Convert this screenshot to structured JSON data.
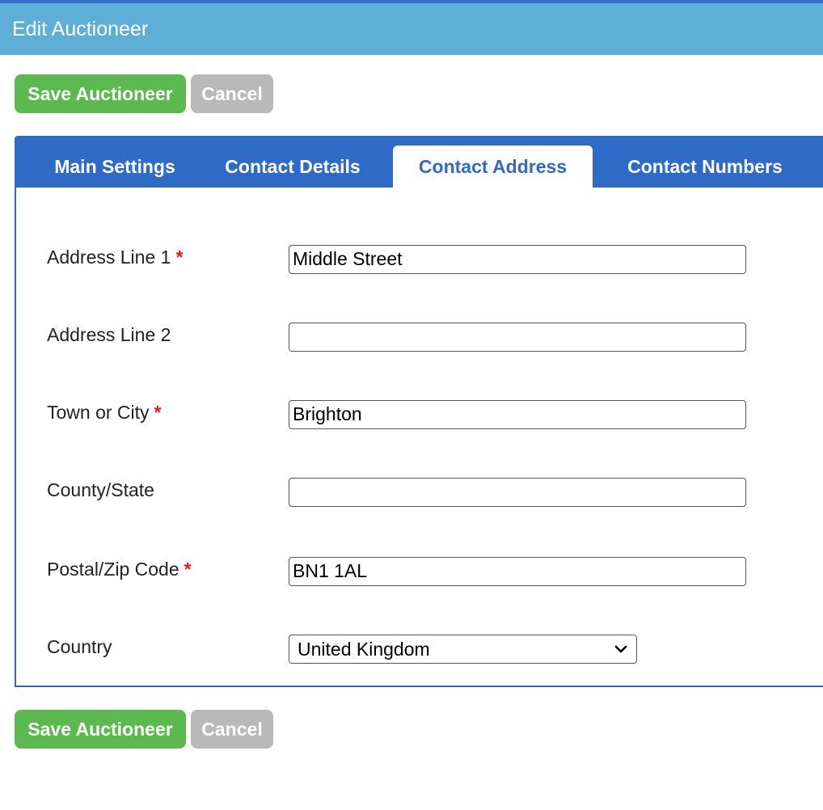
{
  "window": {
    "title": "Edit Auctioneer"
  },
  "toolbar": {
    "save_label": "Save Auctioneer",
    "cancel_label": "Cancel"
  },
  "tabs": [
    {
      "label": "Main Settings",
      "active": false
    },
    {
      "label": "Contact Details",
      "active": false
    },
    {
      "label": "Contact Address",
      "active": true
    },
    {
      "label": "Contact Numbers",
      "active": false
    }
  ],
  "form": {
    "required_marker": "*",
    "fields": [
      {
        "label": "Address Line 1",
        "value": "Middle Street",
        "required": true
      },
      {
        "label": "Address Line 2",
        "value": "",
        "required": false
      },
      {
        "label": "Town or City",
        "value": "Brighton",
        "required": true
      },
      {
        "label": "County/State",
        "value": "",
        "required": false
      },
      {
        "label": "Postal/Zip Code",
        "value": "BN1 1AL",
        "required": true
      }
    ],
    "country": {
      "label": "Country",
      "value": "United Kingdom",
      "icon": "chevron-down-icon"
    }
  },
  "colors": {
    "title_bar": "#5eaed6",
    "tab_bar": "#2f6bc6",
    "save_button": "#5cb94f",
    "cancel_button": "#b9b9b9",
    "required": "#e02020"
  }
}
